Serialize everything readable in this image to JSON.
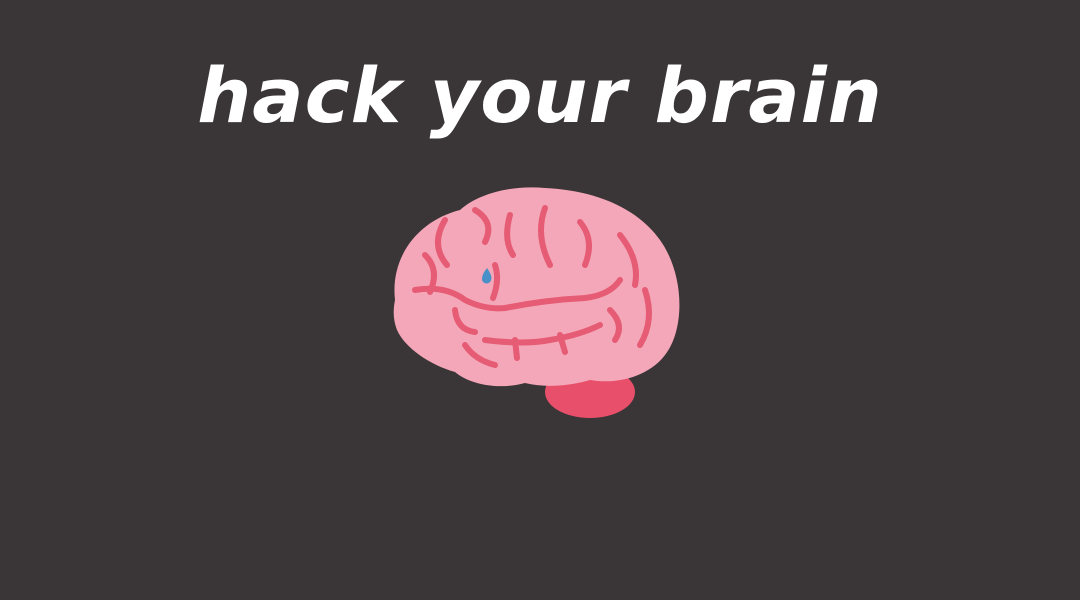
{
  "headline": "hack your brain",
  "illustration": {
    "icon": "brain-icon",
    "colors": {
      "background": "#3a3536",
      "brain_fill": "#f4a7b9",
      "brain_folds": "#e55c74",
      "cerebellum": "#e84f6a",
      "brainstem": "#d9334f",
      "droplet": "#4a90c8"
    }
  }
}
